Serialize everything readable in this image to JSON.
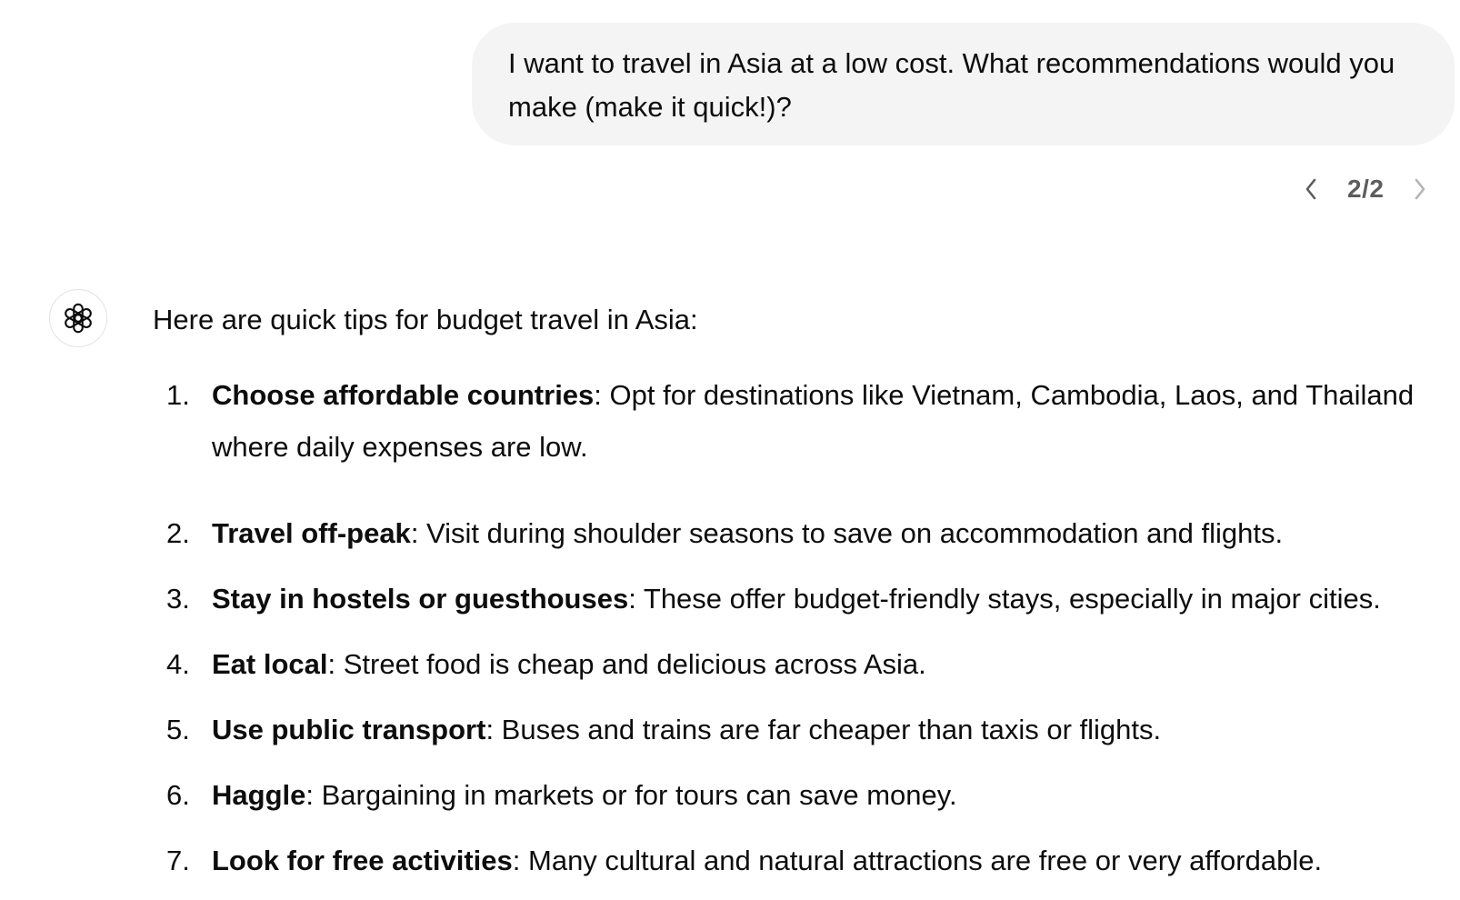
{
  "user_message": {
    "text": "I want to travel in Asia at a low cost. What recommendations would you make (make it quick!)?"
  },
  "pager": {
    "count": "2/2",
    "prev_icon": "chevron-left-icon",
    "next_icon": "chevron-right-icon"
  },
  "assistant": {
    "avatar_icon": "openai-logo-icon",
    "intro": "Here are quick tips for budget travel in Asia:",
    "tips": [
      {
        "num": "1.",
        "title": "Choose affordable countries",
        "text": ": Opt for destinations like Vietnam, Cambodia, Laos, and Thailand where daily expenses are low."
      },
      {
        "num": "2.",
        "title": "Travel off-peak",
        "text": ": Visit during shoulder seasons to save on accommodation and flights."
      },
      {
        "num": "3.",
        "title": "Stay in hostels or guesthouses",
        "text": ": These offer budget-friendly stays, especially in major cities."
      },
      {
        "num": "4.",
        "title": "Eat local",
        "text": ": Street food is cheap and delicious across Asia."
      },
      {
        "num": "5.",
        "title": "Use public transport",
        "text": ": Buses and trains are far cheaper than taxis or flights."
      },
      {
        "num": "6.",
        "title": "Haggle",
        "text": ": Bargaining in markets or for tours can save money."
      },
      {
        "num": "7.",
        "title": "Look for free activities",
        "text": ": Many cultural and natural attractions are free or very affordable."
      }
    ]
  }
}
